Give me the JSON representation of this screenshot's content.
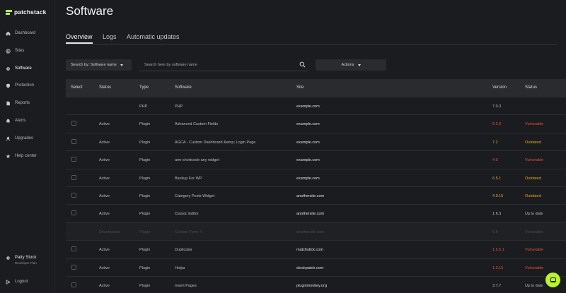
{
  "brand": {
    "name": "patchstack",
    "accent": "#b9f22f"
  },
  "sidebar": {
    "items": [
      {
        "label": "Dashboard",
        "icon": "home-icon"
      },
      {
        "label": "Sites",
        "icon": "globe-icon"
      },
      {
        "label": "Software",
        "icon": "gear-icon",
        "active": true
      },
      {
        "label": "Protection",
        "icon": "shield-icon"
      },
      {
        "label": "Reports",
        "icon": "document-icon"
      },
      {
        "label": "Alerts",
        "icon": "bell-icon"
      },
      {
        "label": "Upgrades",
        "icon": "rocket-icon"
      },
      {
        "label": "Help center",
        "icon": "help-icon"
      }
    ],
    "user": {
      "name": "Patty Stock",
      "plan": "Developer Plan",
      "icon": "settings-icon"
    },
    "logout": "Logout"
  },
  "page": {
    "title": "Software"
  },
  "tabs": [
    {
      "label": "Overview",
      "active": true
    },
    {
      "label": "Logs"
    },
    {
      "label": "Automatic updates"
    }
  ],
  "toolbar": {
    "search_by": "Search by: Software name",
    "search_placeholder": "Search here by software name",
    "actions_label": "Actions"
  },
  "table": {
    "columns": [
      "Select",
      "Status",
      "Type",
      "Software",
      "Site",
      "Version",
      "Status"
    ],
    "rows": [
      {
        "checkbox": false,
        "status": "",
        "type": "PHP",
        "software": "PHP",
        "site": "example.com",
        "version": "7.0.3",
        "state": "",
        "color": "#b9bbc0"
      },
      {
        "checkbox": true,
        "status": "Active",
        "type": "Plugin",
        "software": "Advanced Custom Fields",
        "site": "example.com",
        "version": "6.2.0",
        "state": "Vulnerable",
        "color": "#e0533d"
      },
      {
        "checkbox": true,
        "status": "Active",
        "type": "Plugin",
        "software": "AGCA - Custom Dashboard &amp; Login Page",
        "site": "example.com",
        "version": "7.2",
        "state": "Outdated",
        "color": "#e8a32a"
      },
      {
        "checkbox": true,
        "status": "Active",
        "type": "Plugin",
        "software": "amr shortcode any widget",
        "site": "example.com",
        "version": "4.0",
        "state": "Vulnerable",
        "color": "#e0533d"
      },
      {
        "checkbox": true,
        "status": "Active",
        "type": "Plugin",
        "software": "Backup For WP",
        "site": "example.com",
        "version": "6.5.1",
        "state": "Outdated",
        "color": "#e8a32a"
      },
      {
        "checkbox": true,
        "status": "Active",
        "type": "Plugin",
        "software": "Category Posts Widget",
        "site": "anothersite.com",
        "version": "4.9.15",
        "state": "Outdated",
        "color": "#e8a32a"
      },
      {
        "checkbox": true,
        "status": "Active",
        "type": "Plugin",
        "software": "Classic Editor",
        "site": "anothersite.com",
        "version": "1.6.3",
        "state": "Up to date",
        "color": "#b9bbc0"
      },
      {
        "checkbox": false,
        "status": "Deactivated",
        "type": "Plugin",
        "software": "Contact Form 7",
        "site": "anothersite.com",
        "version": "5.8",
        "state": "Vulnerable",
        "color": "#4a4c51",
        "dim": true
      },
      {
        "checkbox": true,
        "status": "Active",
        "type": "Plugin",
        "software": "Duplicator",
        "site": "matchstick.com",
        "version": "1.5.5.1",
        "state": "Vulnerable",
        "color": "#e0533d"
      },
      {
        "checkbox": true,
        "status": "Active",
        "type": "Plugin",
        "software": "Hotjar",
        "site": "stockpatch.com",
        "version": "1.0.15",
        "state": "Vulnerable",
        "color": "#e0533d"
      },
      {
        "checkbox": true,
        "status": "Active",
        "type": "Plugin",
        "software": "Insert Pages",
        "site": "pluginmonkey.org",
        "version": "3.7.7",
        "state": "Up to date",
        "color": "#b9bbc0"
      }
    ]
  }
}
